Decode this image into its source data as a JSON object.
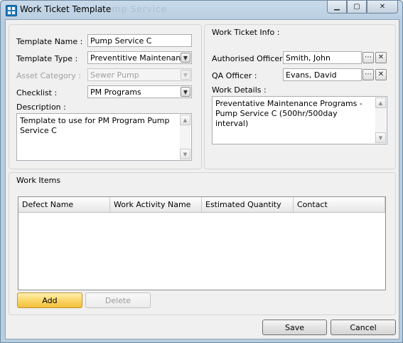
{
  "window": {
    "title": "Work Ticket Template",
    "title_ghost": "Pump Service"
  },
  "template": {
    "name_label": "Template Name :",
    "name_value": "Pump Service C",
    "type_label": "Template Type :",
    "type_value": "Preventitive Maintenance",
    "asset_label": "Asset Category :",
    "asset_value": "Sewer Pump",
    "checklist_label": "Checklist :",
    "checklist_value": "PM Programs",
    "description_label": "Description :",
    "description_value": "Template to use for PM Program Pump Service C"
  },
  "ticket_info": {
    "title": "Work Ticket Info :",
    "authorised_label": "Authorised Officer :",
    "authorised_value": "Smith, John",
    "qa_label": "QA Officer :",
    "qa_value": "Evans, David",
    "details_label": "Work Details :",
    "details_value": "Preventative Maintenance Programs - Pump Service C (500hr/500day interval)"
  },
  "work_items": {
    "title": "Work Items",
    "columns": [
      "Defect Name",
      "Work Activity Name",
      "Estimated Quantity",
      "Contact"
    ],
    "add_label": "Add",
    "delete_label": "Delete"
  },
  "footer": {
    "save_label": "Save",
    "cancel_label": "Cancel"
  }
}
